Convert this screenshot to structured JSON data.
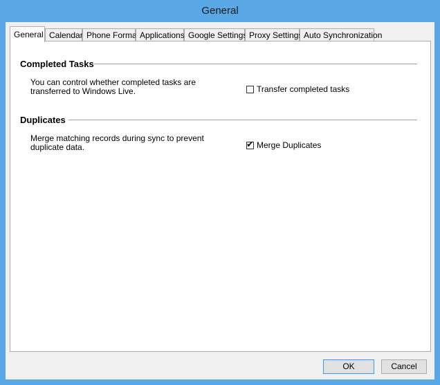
{
  "window": {
    "title": "General"
  },
  "tabs": [
    {
      "label": "General",
      "active": true
    },
    {
      "label": "Calendar",
      "active": false
    },
    {
      "label": "Phone Format",
      "active": false
    },
    {
      "label": "Applications",
      "active": false
    },
    {
      "label": "Google Settings",
      "active": false
    },
    {
      "label": "Proxy Settings",
      "active": false
    },
    {
      "label": "Auto Synchronization",
      "active": false
    }
  ],
  "completed_tasks": {
    "title": "Completed Tasks",
    "description": "You can control whether completed tasks are transferred to Windows Live.",
    "checkbox_label": "Transfer completed tasks",
    "checked": false
  },
  "duplicates": {
    "title": "Duplicates",
    "description": "Merge matching records during sync to prevent duplicate data.",
    "checkbox_label": "Merge Duplicates",
    "checked": true
  },
  "buttons": {
    "ok": "OK",
    "cancel": "Cancel"
  }
}
